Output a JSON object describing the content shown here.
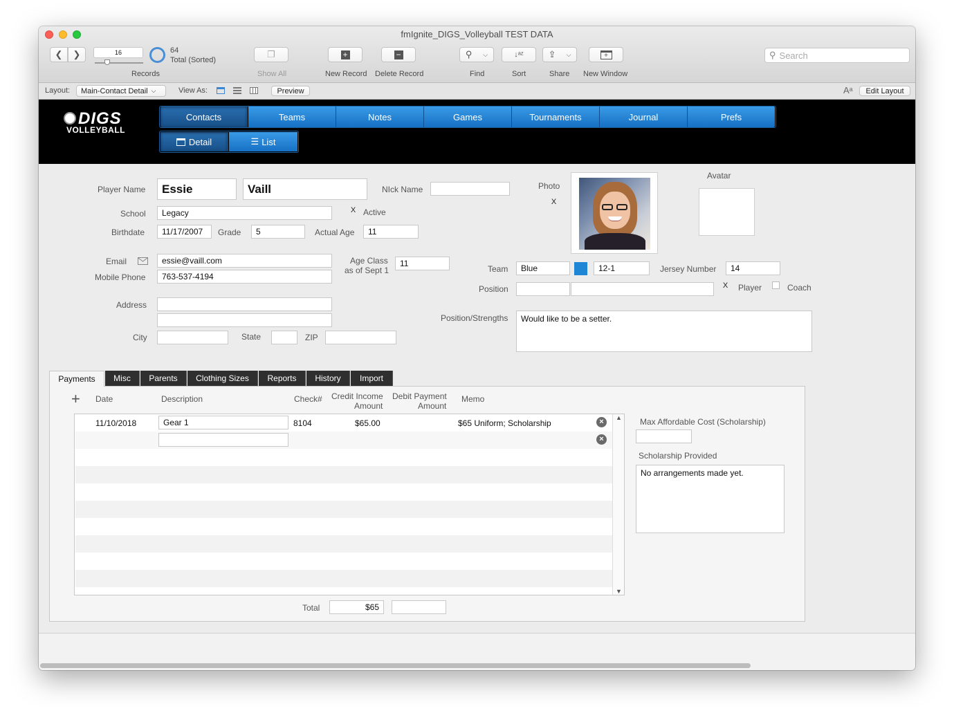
{
  "window": {
    "title": "fmIgnite_DIGS_Volleyball TEST DATA"
  },
  "toolbar": {
    "record_number": "16",
    "records_label": "Records",
    "total_count": "64",
    "total_label": "Total (Sorted)",
    "show_all": "Show All",
    "new_record": "New Record",
    "delete_record": "Delete Record",
    "find": "Find",
    "sort": "Sort",
    "share": "Share",
    "new_window": "New Window",
    "search_placeholder": "Search"
  },
  "layoutbar": {
    "layout_label": "Layout:",
    "layout_value": "Main-Contact Detail",
    "view_as_label": "View As:",
    "preview": "Preview",
    "edit_layout": "Edit Layout",
    "font_icon_text": "Aᵃ"
  },
  "logo": {
    "line1": "DIGS",
    "line2": "VOLLEYBALL"
  },
  "nav": {
    "tabs": [
      "Contacts",
      "Teams",
      "Notes",
      "Games",
      "Tournaments",
      "Journal",
      "Prefs"
    ],
    "subtabs": [
      "Detail",
      "List"
    ]
  },
  "form": {
    "player_name_label": "Player Name",
    "first_name": "Essie",
    "last_name": "Vaill",
    "nick_name_label": "NIck Name",
    "nick_name": "",
    "school_label": "School",
    "school": "Legacy",
    "active_mark": "X",
    "active_label": "Active",
    "birthdate_label": "Birthdate",
    "birthdate": "11/17/2007",
    "grade_label": "Grade",
    "grade": "5",
    "actual_age_label": "Actual Age",
    "actual_age": "11",
    "email_label": "Email",
    "email": "essie@vaill.com",
    "mobile_label": "Mobile Phone",
    "mobile": "763-537-4194",
    "age_class_label_1": "Age Class",
    "age_class_label_2": "as of Sept 1",
    "age_class": "11",
    "address_label": "Address",
    "city_label": "City",
    "state_label": "State",
    "zip_label": "ZIP",
    "photo_label": "Photo",
    "photo_mark": "X",
    "avatar_label": "Avatar",
    "team_label": "Team",
    "team": "Blue",
    "team_color": "#1f86d6",
    "record": "12-1",
    "jersey_label": "Jersey Number",
    "jersey": "14",
    "position_label": "Position",
    "player_mark": "X",
    "player_label": "Player",
    "coach_label": "Coach",
    "strengths_label": "Position/Strengths",
    "strengths": "Would like to be a setter."
  },
  "tabs": {
    "items": [
      "Payments",
      "Misc",
      "Parents",
      "Clothing Sizes",
      "Reports",
      "History",
      "Import"
    ]
  },
  "payments": {
    "headers": {
      "date": "Date",
      "description": "Description",
      "check": "Check#",
      "credit_1": "Credit Income",
      "credit_2": "Amount",
      "debit_1": "Debit Payment",
      "debit_2": "Amount",
      "memo": "Memo"
    },
    "rows": [
      {
        "date": "11/10/2018",
        "description": "Gear 1",
        "check": "8104",
        "credit": "$65.00",
        "debit": "",
        "memo": "$65 Uniform; Scholarship"
      }
    ],
    "total_label": "Total",
    "total_credit": "$65",
    "total_debit": "",
    "max_cost_label": "Max Affordable Cost (Scholarship)",
    "max_cost": "",
    "scholarship_label": "Scholarship Provided",
    "scholarship": "No arrangements made yet."
  }
}
